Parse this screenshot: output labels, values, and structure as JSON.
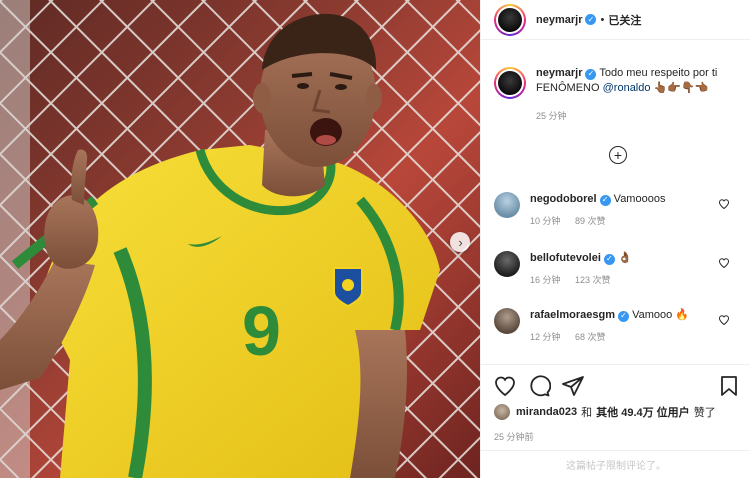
{
  "post": {
    "author": "neymarjr",
    "verified": true,
    "follow_separator": "•",
    "follow_state": "已关注"
  },
  "caption": {
    "username": "neymarjr",
    "text": "Todo meu respeito por ti FENÔMENO",
    "mention": "@ronaldo",
    "emojis": "👆🏾👉🏾👇🏾👈🏾",
    "time": "25 分钟"
  },
  "comments": [
    {
      "username": "negodoborel",
      "verified": true,
      "text": "Vamoooos",
      "time": "10 分钟",
      "likes": "89 次赞",
      "avatar_color": "#6b8fa8"
    },
    {
      "username": "bellofutevolei",
      "verified": true,
      "text": "👌🏾",
      "time": "16 分钟",
      "likes": "123 次赞",
      "avatar_color": "#3b3b3b"
    },
    {
      "username": "rafaelmoraesgm",
      "verified": true,
      "text": "Vamooo 🔥",
      "time": "12 分钟",
      "likes": "68 次赞",
      "avatar_color": "#7a6a5e"
    }
  ],
  "likes_line": {
    "user": "miranda023",
    "and": "和",
    "others": "其他 49.4万 位用户",
    "suffix": "赞了"
  },
  "post_time": "25 分钟前",
  "comments_disabled": "这篇帖子限制评论了。",
  "jersey_number": "9",
  "icons": {
    "verified": "verified-badge-icon",
    "like": "heart-icon",
    "comment": "comment-bubble-icon",
    "share": "paper-plane-icon",
    "save": "bookmark-icon",
    "more": "plus-circle-icon",
    "next": "chevron-right-icon"
  },
  "colors": {
    "jersey_yellow": "#f4d21f",
    "jersey_green": "#2e8b3a",
    "verified_blue": "#3897f0",
    "mention_blue": "#00376b"
  }
}
